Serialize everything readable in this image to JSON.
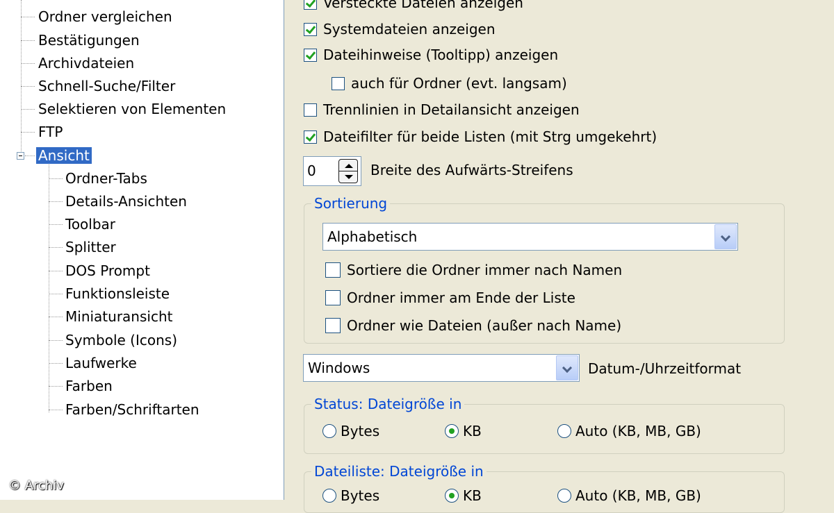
{
  "tree": {
    "items": [
      {
        "label": "Ordner vergleichen"
      },
      {
        "label": "Bestätigungen"
      },
      {
        "label": "Archivdateien"
      },
      {
        "label": "Schnell-Suche/Filter"
      },
      {
        "label": "Selektieren von Elementen"
      },
      {
        "label": "FTP"
      },
      {
        "label": "Ansicht",
        "selected": true,
        "expanded": true
      },
      {
        "label": "Ordner-Tabs"
      },
      {
        "label": "Details-Ansichten"
      },
      {
        "label": "Toolbar"
      },
      {
        "label": "Splitter"
      },
      {
        "label": "DOS Prompt"
      },
      {
        "label": "Funktionsleiste"
      },
      {
        "label": "Miniaturansicht"
      },
      {
        "label": "Symbole (Icons)"
      },
      {
        "label": "Laufwerke"
      },
      {
        "label": "Farben"
      },
      {
        "label": "Farben/Schriftarten"
      }
    ]
  },
  "watermark": "© Archiv",
  "options": {
    "checkboxes": [
      {
        "label": "Versteckte Dateien anzeigen",
        "checked": true
      },
      {
        "label": "Systemdateien anzeigen",
        "checked": true
      },
      {
        "label": "Dateihinweise (Tooltipp) anzeigen",
        "checked": true
      },
      {
        "label": "auch für Ordner (evt. langsam)",
        "checked": false
      },
      {
        "label": "Trennlinien in Detailansicht anzeigen",
        "checked": false
      },
      {
        "label": "Dateifilter für beide Listen (mit Strg umgekehrt)",
        "checked": true
      }
    ],
    "spinner": {
      "value": "0",
      "label": "Breite des Aufwärts-Streifens"
    },
    "sort_group": {
      "title": "Sortierung",
      "select_value": "Alphabetisch",
      "checkboxes": [
        {
          "label": "Sortiere die Ordner immer nach Namen",
          "checked": false
        },
        {
          "label": "Ordner immer am Ende der Liste",
          "checked": false
        },
        {
          "label": "Ordner wie Dateien (außer nach Name)",
          "checked": false
        }
      ]
    },
    "date_format": {
      "select_value": "Windows",
      "label": "Datum-/Uhrzeitformat"
    },
    "status_group": {
      "title": "Status: Dateigröße in",
      "radios": [
        {
          "label": "Bytes",
          "checked": false
        },
        {
          "label": "KB",
          "checked": true
        },
        {
          "label": "Auto (KB, MB, GB)",
          "checked": false
        }
      ]
    },
    "filelist_group": {
      "title": "Dateiliste: Dateigröße in",
      "radios": [
        {
          "label": "Bytes",
          "checked": false
        },
        {
          "label": "KB",
          "checked": true
        },
        {
          "label": "Auto (KB, MB, GB)",
          "checked": false
        }
      ]
    }
  }
}
